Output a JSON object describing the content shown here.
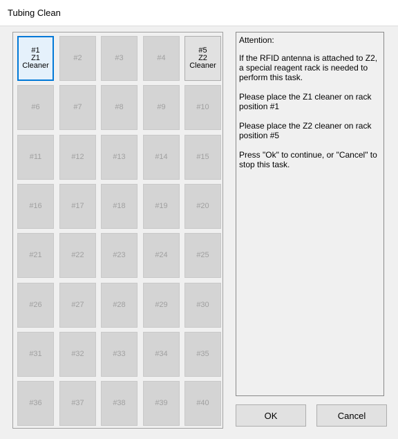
{
  "window": {
    "title": "Tubing Clean"
  },
  "rack": {
    "slots": [
      {
        "lines": [
          "#1",
          "Z1",
          "Cleaner"
        ],
        "state": "selected"
      },
      {
        "lines": [
          "#2"
        ],
        "state": "disabled"
      },
      {
        "lines": [
          "#3"
        ],
        "state": "disabled"
      },
      {
        "lines": [
          "#4"
        ],
        "state": "disabled"
      },
      {
        "lines": [
          "#5",
          "Z2",
          "Cleaner"
        ],
        "state": "active"
      },
      {
        "lines": [
          "#6"
        ],
        "state": "disabled"
      },
      {
        "lines": [
          "#7"
        ],
        "state": "disabled"
      },
      {
        "lines": [
          "#8"
        ],
        "state": "disabled"
      },
      {
        "lines": [
          "#9"
        ],
        "state": "disabled"
      },
      {
        "lines": [
          "#10"
        ],
        "state": "disabled"
      },
      {
        "lines": [
          "#11"
        ],
        "state": "disabled"
      },
      {
        "lines": [
          "#12"
        ],
        "state": "disabled"
      },
      {
        "lines": [
          "#13"
        ],
        "state": "disabled"
      },
      {
        "lines": [
          "#14"
        ],
        "state": "disabled"
      },
      {
        "lines": [
          "#15"
        ],
        "state": "disabled"
      },
      {
        "lines": [
          "#16"
        ],
        "state": "disabled"
      },
      {
        "lines": [
          "#17"
        ],
        "state": "disabled"
      },
      {
        "lines": [
          "#18"
        ],
        "state": "disabled"
      },
      {
        "lines": [
          "#19"
        ],
        "state": "disabled"
      },
      {
        "lines": [
          "#20"
        ],
        "state": "disabled"
      },
      {
        "lines": [
          "#21"
        ],
        "state": "disabled"
      },
      {
        "lines": [
          "#22"
        ],
        "state": "disabled"
      },
      {
        "lines": [
          "#23"
        ],
        "state": "disabled"
      },
      {
        "lines": [
          "#24"
        ],
        "state": "disabled"
      },
      {
        "lines": [
          "#25"
        ],
        "state": "disabled"
      },
      {
        "lines": [
          "#26"
        ],
        "state": "disabled"
      },
      {
        "lines": [
          "#27"
        ],
        "state": "disabled"
      },
      {
        "lines": [
          "#28"
        ],
        "state": "disabled"
      },
      {
        "lines": [
          "#29"
        ],
        "state": "disabled"
      },
      {
        "lines": [
          "#30"
        ],
        "state": "disabled"
      },
      {
        "lines": [
          "#31"
        ],
        "state": "disabled"
      },
      {
        "lines": [
          "#32"
        ],
        "state": "disabled"
      },
      {
        "lines": [
          "#33"
        ],
        "state": "disabled"
      },
      {
        "lines": [
          "#34"
        ],
        "state": "disabled"
      },
      {
        "lines": [
          "#35"
        ],
        "state": "disabled"
      },
      {
        "lines": [
          "#36"
        ],
        "state": "disabled"
      },
      {
        "lines": [
          "#37"
        ],
        "state": "disabled"
      },
      {
        "lines": [
          "#38"
        ],
        "state": "disabled"
      },
      {
        "lines": [
          "#39"
        ],
        "state": "disabled"
      },
      {
        "lines": [
          "#40"
        ],
        "state": "disabled"
      }
    ]
  },
  "info": {
    "heading": "Attention:",
    "paragraphs": [
      "If the RFID antenna is attached to Z2, a special reagent rack is needed to perform this task.",
      "Please place the Z1 cleaner on rack position #1",
      "Please place the Z2 cleaner on rack position #5",
      "Press \"Ok\" to continue, or \"Cancel\" to stop this task."
    ]
  },
  "buttons": {
    "ok": "OK",
    "cancel": "Cancel"
  },
  "colors": {
    "selected_border": "#0078d7",
    "disabled_slot": "#d4d4d4",
    "disabled_text": "#a0a0a0"
  }
}
